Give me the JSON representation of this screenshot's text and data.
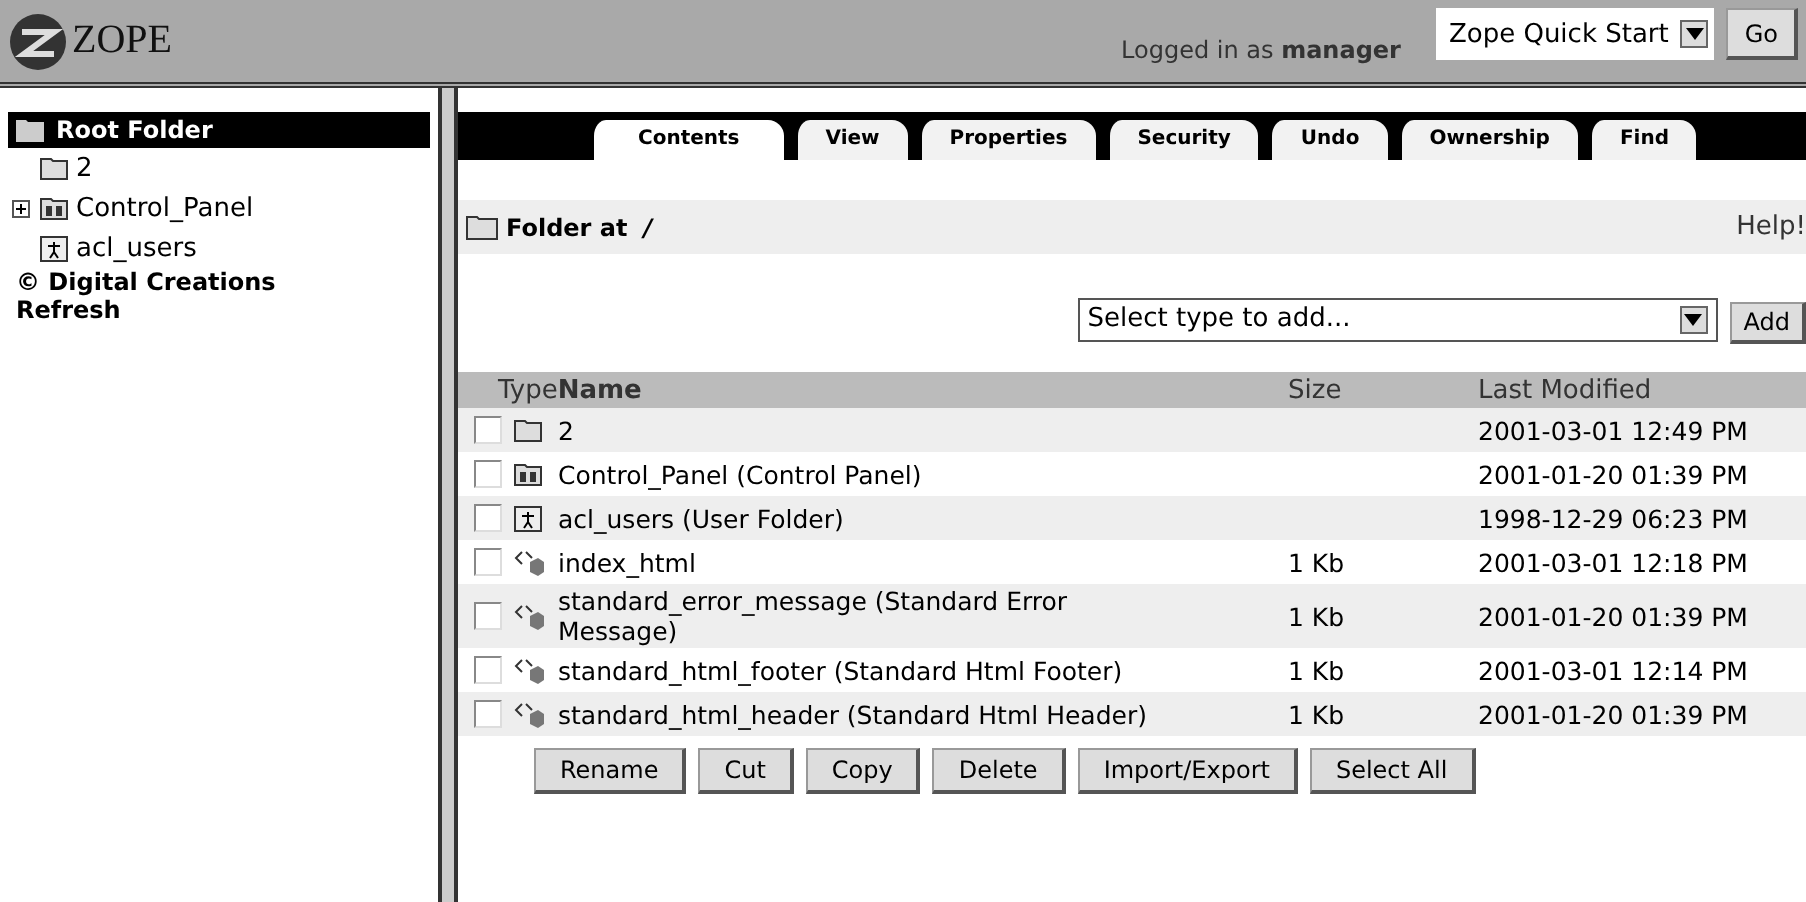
{
  "header": {
    "logo": "ZOPE",
    "login_prefix": "Logged in as ",
    "login_user": "manager",
    "quick_select": "Zope Quick Start",
    "go_button": "Go"
  },
  "tree": {
    "root": "Root Folder",
    "items": [
      {
        "label": "2",
        "kind": "folder",
        "expandable": false
      },
      {
        "label": "Control_Panel",
        "kind": "control-panel",
        "expandable": true
      },
      {
        "label": "acl_users",
        "kind": "user-folder",
        "expandable": false
      }
    ],
    "footer": "© Digital Creations",
    "refresh": "Refresh"
  },
  "tabs": [
    {
      "label": "Contents",
      "selected": true
    },
    {
      "label": "View",
      "selected": false
    },
    {
      "label": "Properties",
      "selected": false
    },
    {
      "label": "Security",
      "selected": false
    },
    {
      "label": "Undo",
      "selected": false
    },
    {
      "label": "Ownership",
      "selected": false
    },
    {
      "label": "Find",
      "selected": false
    }
  ],
  "location": {
    "label": "Folder at",
    "path": "/",
    "help": "Help!"
  },
  "add": {
    "placeholder": "Select type to add...",
    "button": "Add"
  },
  "table": {
    "columns": [
      "Type",
      "Name",
      "Size",
      "Last Modified"
    ],
    "rows": [
      {
        "kind": "folder",
        "name": "2",
        "size": "",
        "modified": "2001-03-01 12:49 PM",
        "checked": false
      },
      {
        "kind": "control-panel",
        "name": "Control_Panel (Control Panel)",
        "size": "",
        "modified": "2001-01-20 01:39 PM",
        "checked": false
      },
      {
        "kind": "user-folder",
        "name": "acl_users (User Folder)",
        "size": "",
        "modified": "1998-12-29 06:23 PM",
        "checked": false
      },
      {
        "kind": "dtml",
        "name": "index_html",
        "size": "1 Kb",
        "modified": "2001-03-01 12:18 PM",
        "checked": false
      },
      {
        "kind": "dtml",
        "name": "standard_error_message (Standard Error Message)",
        "size": "1 Kb",
        "modified": "2001-01-20 01:39 PM",
        "checked": false
      },
      {
        "kind": "dtml",
        "name": "standard_html_footer (Standard Html Footer)",
        "size": "1 Kb",
        "modified": "2001-03-01 12:14 PM",
        "checked": false
      },
      {
        "kind": "dtml",
        "name": "standard_html_header (Standard Html Header)",
        "size": "1 Kb",
        "modified": "2001-01-20 01:39 PM",
        "checked": false
      }
    ]
  },
  "actions": [
    "Rename",
    "Cut",
    "Copy",
    "Delete",
    "Import/Export",
    "Select All"
  ]
}
